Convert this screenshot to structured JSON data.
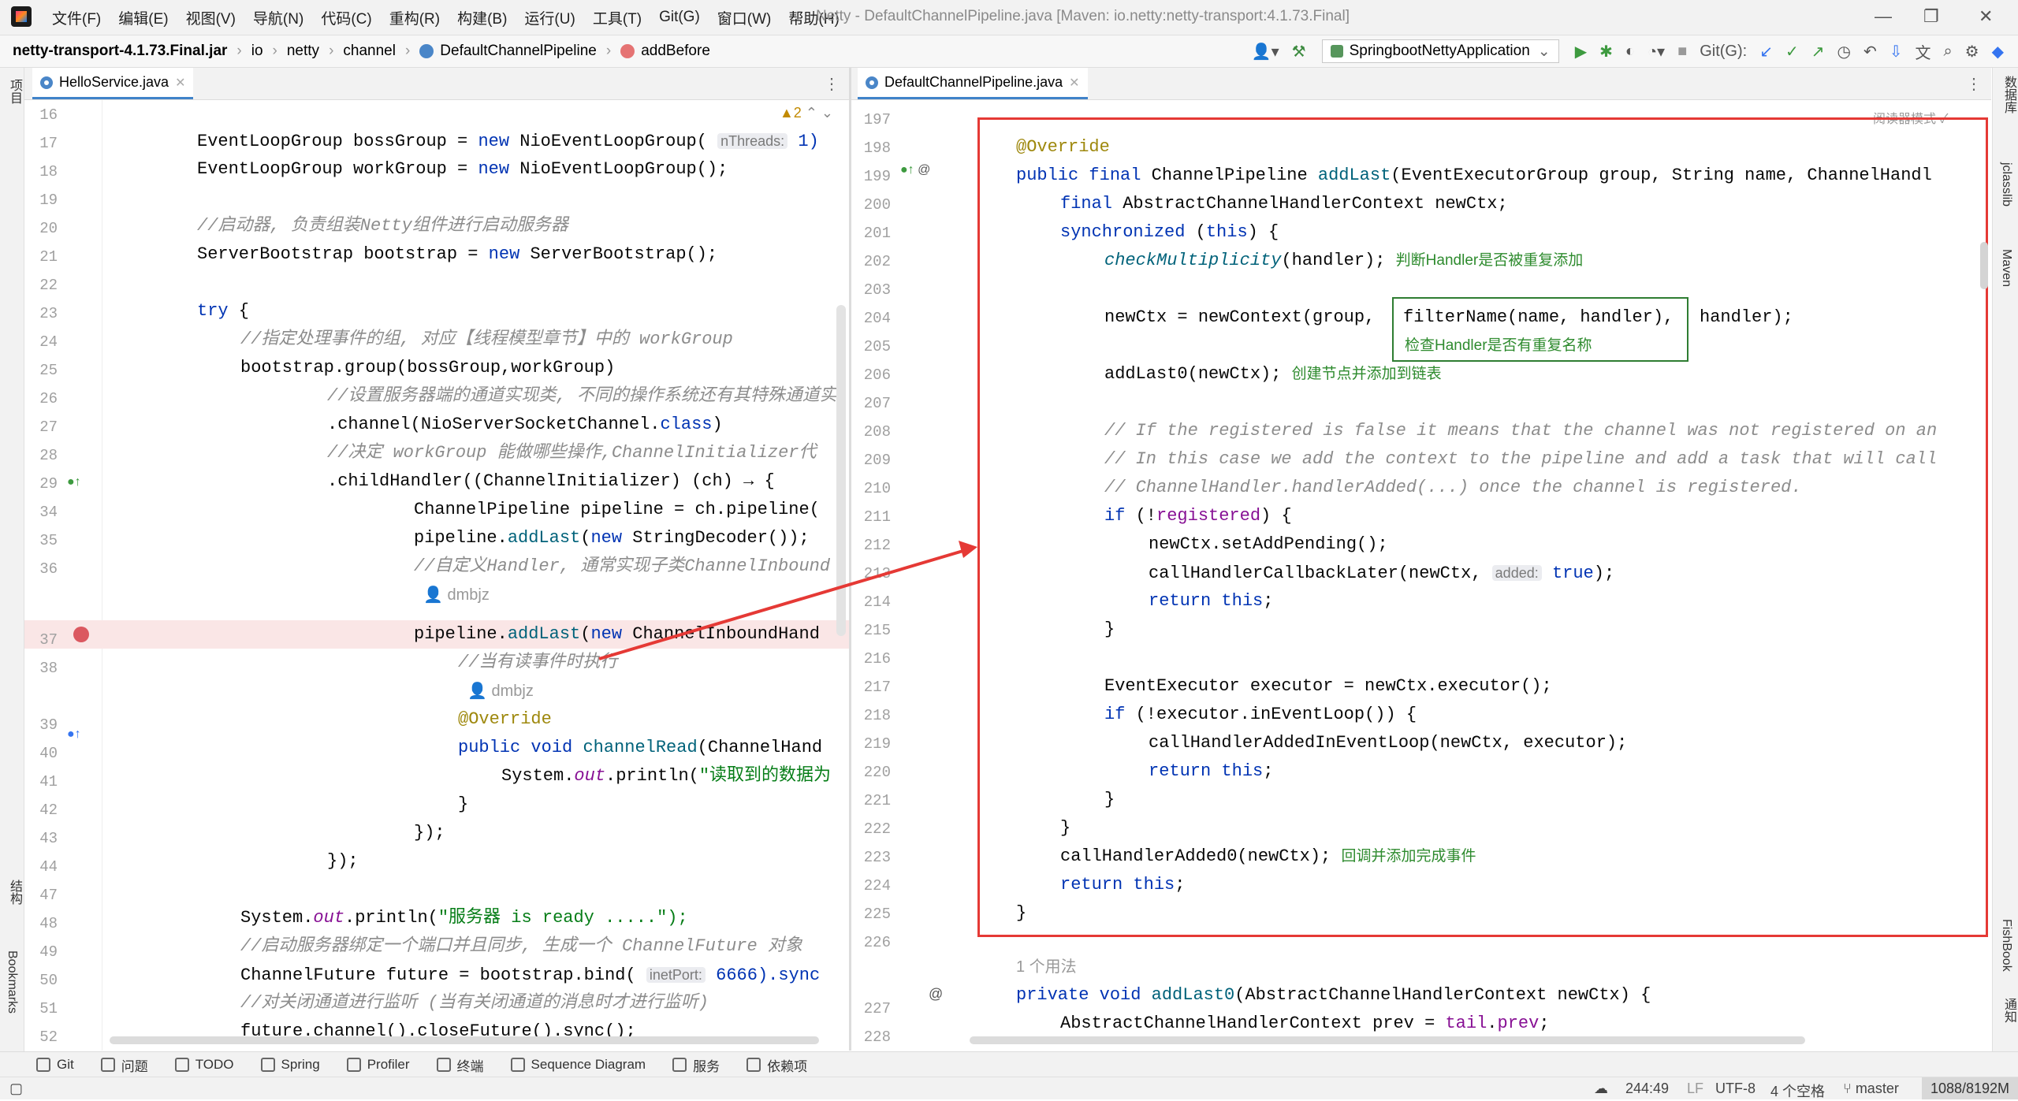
{
  "menu": [
    "文件(F)",
    "编辑(E)",
    "视图(V)",
    "导航(N)",
    "代码(C)",
    "重构(R)",
    "构建(B)",
    "运行(U)",
    "工具(T)",
    "Git(G)",
    "窗口(W)",
    "帮助(H)"
  ],
  "window_title": "Netty - DefaultChannelPipeline.java [Maven: io.netty:netty-transport:4.1.73.Final]",
  "breadcrumb": [
    "netty-transport-4.1.73.Final.jar",
    "io",
    "netty",
    "channel",
    "DefaultChannelPipeline",
    "addBefore"
  ],
  "run_config": "SpringbootNettyApplication",
  "git_label": "Git(G):",
  "left_stripe": [
    "项目",
    "结构",
    "Bookmarks"
  ],
  "right_stripe": [
    "数据库",
    "jclasslib",
    "Maven",
    "FishBook",
    "通知"
  ],
  "left_tab": "HelloService.java",
  "right_tab": "DefaultChannelPipeline.java",
  "warnings": "▲2",
  "reader_mode": "阅读器模式",
  "usage_hint": "1 个用法",
  "left_lines": [
    "16",
    "17",
    "18",
    "19",
    "20",
    "21",
    "22",
    "23",
    "24",
    "25",
    "26",
    "27",
    "28",
    "29",
    "34",
    "35",
    "36",
    "",
    "37",
    "38",
    "",
    "39",
    "40",
    "41",
    "42",
    "43",
    "44",
    "47",
    "48",
    "49",
    "50",
    "51",
    "52"
  ],
  "right_lines": [
    "197",
    "198",
    "199",
    "200",
    "201",
    "202",
    "203",
    "204",
    "205",
    "206",
    "207",
    "208",
    "209",
    "210",
    "211",
    "212",
    "213",
    "214",
    "215",
    "216",
    "217",
    "218",
    "219",
    "220",
    "221",
    "222",
    "223",
    "224",
    "225",
    "226",
    "",
    "227",
    "228"
  ],
  "left_code": {
    "l17": "EventLoopGroup bossGroup = new NioEventLoopGroup(",
    "l17hint": "nThreads:",
    "l17end": "1)",
    "l18": "EventLoopGroup workGroup = new NioEventLoopGroup();",
    "l20": "//启动器, 负责组装Netty组件进行启动服务器",
    "l21": "ServerBootstrap bootstrap = new ServerBootstrap();",
    "l23": "try {",
    "l24": "//指定处理事件的组, 对应【线程模型章节】中的 workGroup",
    "l25": "bootstrap.group(bossGroup,workGroup)",
    "l26": "//设置服务器端的通道实现类, 不同的操作系统还有其特殊通道实",
    "l27": ".channel(NioServerSocketChannel.class)",
    "l28": "//决定 workGroup 能做哪些操作,ChannelInitializer代",
    "l29": ".childHandler((ChannelInitializer) (ch) → {",
    "l34": "ChannelPipeline pipeline = ch.pipeline(",
    "l35": "pipeline.addLast(new StringDecoder());",
    "l36": "//自定义Handler, 通常实现子类ChannelInbound",
    "author1": "dmbjz",
    "l37": "pipeline.addLast(new ChannelInboundHand",
    "l38": "//当有读事件时执行",
    "author2": "dmbjz",
    "l39": "@Override",
    "l40": "public void channelRead(ChannelHand",
    "l41": "System.out.println(\"读取到的数据为",
    "l42": "}",
    "l43": "});",
    "l44": "});",
    "l48": "System.out.println(\"服务器 is ready .....\");",
    "l49": "//启动服务器绑定一个端口并且同步, 生成一个 ChannelFuture 对象",
    "l50": "ChannelFuture future = bootstrap.bind(",
    "l50hint": "inetPort:",
    "l50end": "6666).sync",
    "l51": "//对关闭通道进行监听 (当有关闭通道的消息时才进行监听)",
    "l52": "future.channel().closeFuture().sync();"
  },
  "right_code": {
    "r198": "@Override",
    "r199": "public final ChannelPipeline addLast(EventExecutorGroup group, String name, ChannelHandl",
    "r200": "final AbstractChannelHandlerContext newCtx;",
    "r201": "synchronized (this) {",
    "r202": "checkMultiplicity(handler);",
    "r202note": "判断Handler是否被重复添加",
    "r204a": "newCtx = newContext(group,",
    "r204b": "filterName(name, handler),",
    "r204c": "handler);",
    "r205note": "检查Handler是否有重复名称",
    "r206": "addLast0(newCtx);",
    "r206note": "创建节点并添加到链表",
    "r208": "// If the registered is false it means that the channel was not registered on an",
    "r209": "// In this case we add the context to the pipeline and add a task that will call",
    "r210": "// ChannelHandler.handlerAdded(...) once the channel is registered.",
    "r211": "if (!registered) {",
    "r212": "newCtx.setAddPending();",
    "r213a": "callHandlerCallbackLater(newCtx,",
    "r213hint": "added:",
    "r213b": "true);",
    "r214": "return this;",
    "r215": "}",
    "r217": "EventExecutor executor = newCtx.executor();",
    "r218": "if (!executor.inEventLoop()) {",
    "r219": "callHandlerAddedInEventLoop(newCtx, executor);",
    "r220": "return this;",
    "r221": "}",
    "r222": "}",
    "r223": "callHandlerAdded0(newCtx);",
    "r223note": "回调并添加完成事件",
    "r224": "return this;",
    "r225": "}",
    "r227": "private void addLast0(AbstractChannelHandlerContext newCtx) {",
    "r228": "AbstractChannelHandlerContext prev = tail.prev;"
  },
  "tool_windows": [
    "Git",
    "问题",
    "TODO",
    "Spring",
    "Profiler",
    "终端",
    "Sequence Diagram",
    "服务",
    "依赖项"
  ],
  "status": {
    "position": "244:49",
    "line_sep": "LF",
    "encoding": "UTF-8",
    "indent": "4 个空格",
    "branch": "master",
    "memory": "1088/8192M"
  },
  "colors": {
    "highlight_box": "#e53935",
    "note_box": "#2e7d32",
    "breakpoint": "#db5860",
    "keyword": "#0033b3"
  }
}
